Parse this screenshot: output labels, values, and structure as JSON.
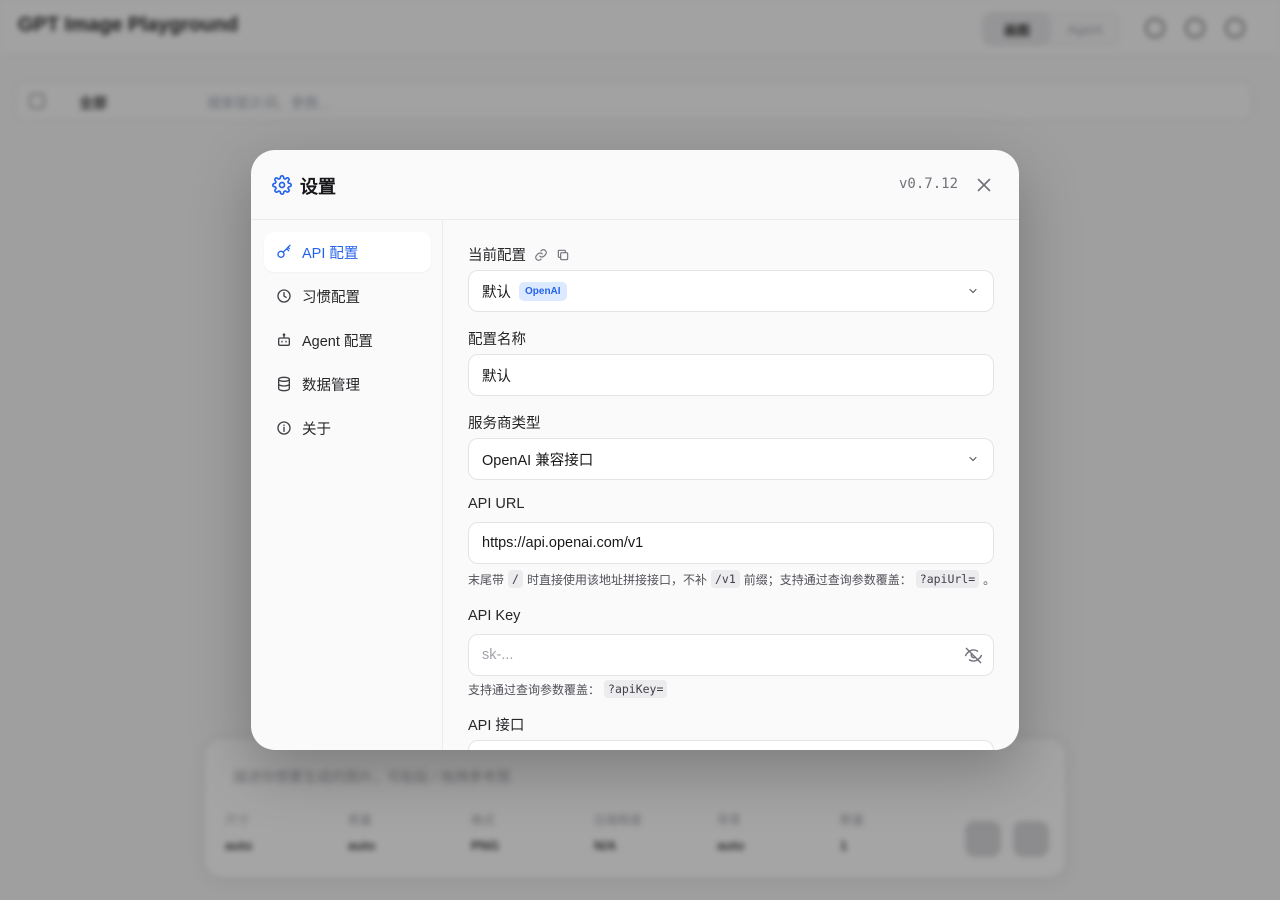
{
  "background": {
    "app_title": "GPT Image Playground",
    "mode_buttons": [
      "画图",
      "Agent"
    ],
    "toolbar": {
      "filter_label": "全部",
      "search_placeholder": "搜索提示词、参数..."
    },
    "composer": {
      "prompt_placeholder": "描述你想要生成的图片，可粘贴 / 拖拽参考图",
      "params": [
        {
          "label": "尺寸",
          "value": "auto"
        },
        {
          "label": "质量",
          "value": "auto"
        },
        {
          "label": "格式",
          "value": "PNG"
        },
        {
          "label": "压缩程度",
          "value": "N/A"
        },
        {
          "label": "背景",
          "value": "auto"
        },
        {
          "label": "数量",
          "value": "1"
        }
      ]
    }
  },
  "modal": {
    "title": "设置",
    "version": "v0.7.12",
    "nav": [
      {
        "label": "API 配置",
        "icon": "key-icon",
        "active": true
      },
      {
        "label": "习惯配置",
        "icon": "clock-icon",
        "active": false
      },
      {
        "label": "Agent 配置",
        "icon": "bot-icon",
        "active": false
      },
      {
        "label": "数据管理",
        "icon": "database-icon",
        "active": false
      },
      {
        "label": "关于",
        "icon": "info-icon",
        "active": false
      }
    ],
    "fields": {
      "current_profile": {
        "label": "当前配置",
        "value": "默认",
        "badge": "OpenAI"
      },
      "profile_name": {
        "label": "配置名称",
        "value": "默认"
      },
      "provider_type": {
        "label": "服务商类型",
        "value": "OpenAI 兼容接口"
      },
      "api_url": {
        "label": "API URL",
        "value": "https://api.openai.com/v1",
        "hint_parts": [
          "末尾带",
          "/",
          "时直接使用该地址拼接接口，不补",
          "/v1",
          "前缀；支持通过查询参数覆盖：",
          "?apiUrl=",
          "。"
        ]
      },
      "api_key": {
        "label": "API Key",
        "placeholder": "sk-...",
        "hint_parts": [
          "支持通过查询参数覆盖：",
          "?apiKey="
        ]
      },
      "api_endpoint": {
        "label": "API 接口"
      }
    },
    "accent_color": "#2563eb"
  }
}
